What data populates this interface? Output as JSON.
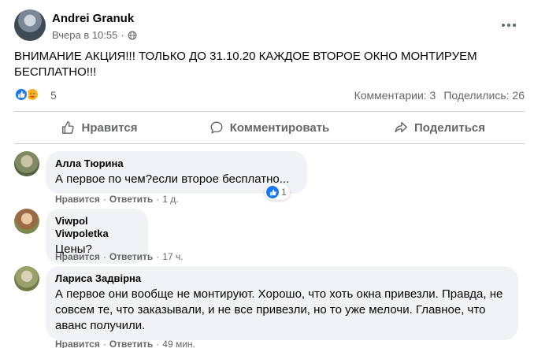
{
  "post": {
    "author": "Andrei Granuk",
    "time": "Вчера в 10:55",
    "dot": "·",
    "text": "ВНИМАНИЕ АКЦИЯ!!! ТОЛЬКО ДО 31.10.20 КАЖДОЕ ВТОРОЕ ОКНО МОНТИРУЕМ БЕСПЛАТНО!!!"
  },
  "stats": {
    "reactions_count": "5",
    "comments": "Комментарии: 3",
    "shares": "Поделились: 26"
  },
  "actions": {
    "like": "Нравится",
    "comment": "Комментировать",
    "share": "Поделиться"
  },
  "comments": [
    {
      "author": "Алла Тюрина",
      "text": "А первое по чем?если второе бесплатно...",
      "like": "Нравится",
      "reply": "Ответить",
      "time": "1 д.",
      "reactions": "1"
    },
    {
      "author": "Viwpol Viwpoletka",
      "text": "Цены?",
      "like": "Нравится",
      "reply": "Ответить",
      "time": "17 ч."
    },
    {
      "author": "Лариса Задвірна",
      "text": "А первое они вообще не монтируют. Хорошо, что хоть окна привезли. Правда, не совсем те, что заказывали, и не все привезли, но то уже мелочи. Главное, что аванс получили.",
      "like": "Нравится",
      "reply": "Ответить",
      "time": "49 мин."
    }
  ],
  "separator": "·",
  "colors": {
    "accent": "#1877f2",
    "secondary_text": "#65676b",
    "bubble_bg": "#f0f2f5"
  },
  "icons": [
    "globe-icon",
    "more-icon",
    "like-icon",
    "comment-icon",
    "share-icon",
    "care-reaction-icon"
  ]
}
